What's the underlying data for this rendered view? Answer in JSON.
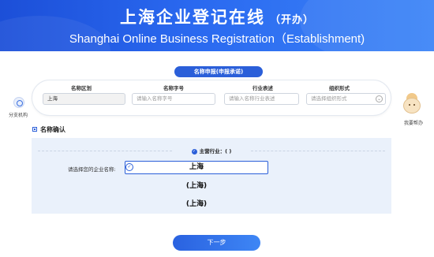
{
  "header": {
    "title": "上海企业登记在线",
    "title_suffix": "（开办）",
    "subtitle": "Shanghai Online Business Registration（Establishment)"
  },
  "section": {
    "pill_label": "名称申报(申报承诺)"
  },
  "form": {
    "district": {
      "label": "名称区划",
      "value": "上海"
    },
    "trade_name": {
      "label": "名称字号",
      "placeholder": "请输入名称字号"
    },
    "industry": {
      "label": "行业表述",
      "placeholder": "请输入名称行业表述"
    },
    "org_form": {
      "label": "组织形式",
      "placeholder": "请选择组织形式"
    }
  },
  "sidebar_left": {
    "label": "分支机构",
    "icon": "gear-icon"
  },
  "sidebar_right": {
    "label": "我要帮办",
    "icon": "helper-mascot-icon"
  },
  "confirm": {
    "title": "名称确认",
    "industry_line": "主营行业：( )",
    "choose_label": "请选择您的企业名称:",
    "options": [
      "上海",
      "(上海)",
      "(上海)"
    ]
  },
  "actions": {
    "next_label": "下一步"
  },
  "colors": {
    "primary": "#2b5fd9",
    "panel": "#eaf1fb"
  }
}
